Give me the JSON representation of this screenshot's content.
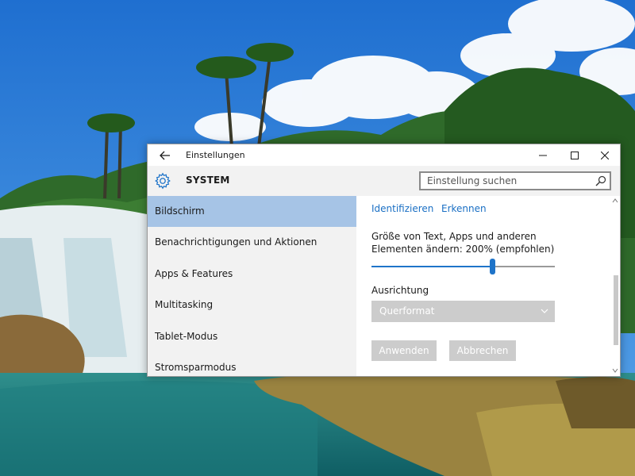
{
  "window": {
    "title": "Einstellungen",
    "section_title": "SYSTEM"
  },
  "search": {
    "placeholder": "Einstellung suchen"
  },
  "nav": {
    "items": [
      {
        "label": "Bildschirm",
        "active": true
      },
      {
        "label": "Benachrichtigungen und Aktionen",
        "active": false
      },
      {
        "label": "Apps & Features",
        "active": false
      },
      {
        "label": "Multitasking",
        "active": false
      },
      {
        "label": "Tablet-Modus",
        "active": false
      },
      {
        "label": "Stromsparmodus",
        "active": false
      }
    ]
  },
  "display": {
    "identify_link": "Identifizieren",
    "detect_link": "Erkennen",
    "scale_description": "Größe von Text, Apps und anderen Elementen ändern: 200% (empfohlen)",
    "scale_slider_fraction": 0.66,
    "orientation_label": "Ausrichtung",
    "orientation_value": "Querformat",
    "apply_button": "Anwenden",
    "cancel_button": "Abbrechen"
  },
  "colors": {
    "accent": "#1f74c9",
    "nav_selected": "#a6c4e6",
    "link": "#1a6fc4",
    "disabled": "#cccccc"
  },
  "icons": {
    "back": "arrow-left-icon",
    "minimize": "minimize-icon",
    "maximize": "maximize-icon",
    "close": "close-icon",
    "settings": "gear-icon",
    "search": "search-icon",
    "dropdown": "chevron-down-icon"
  }
}
